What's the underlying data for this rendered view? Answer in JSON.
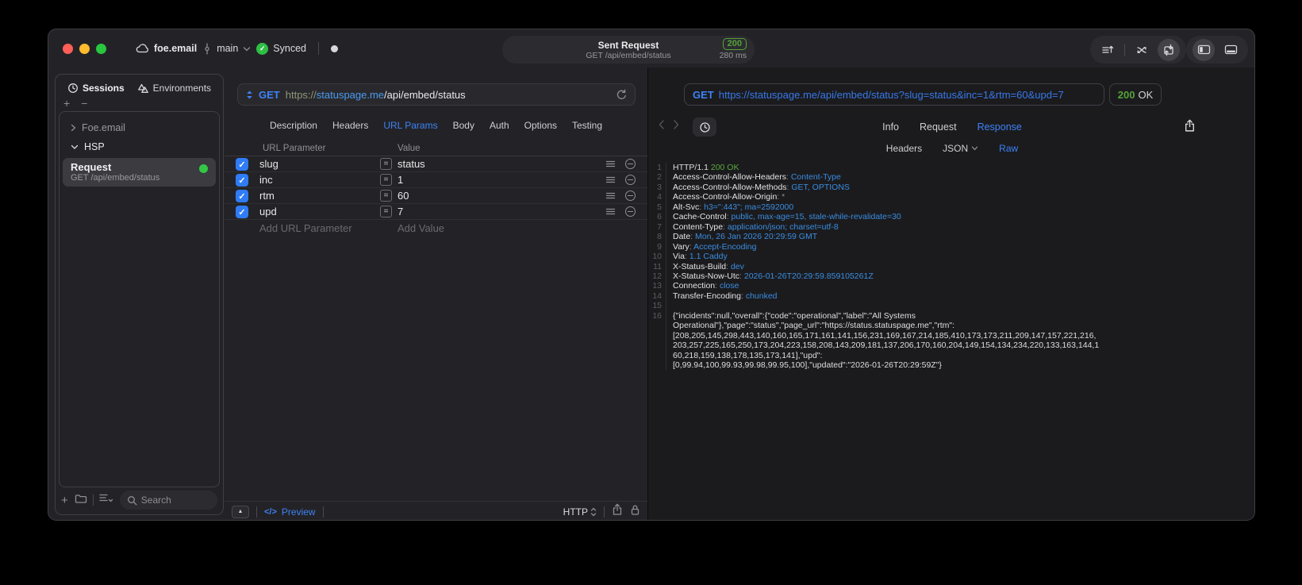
{
  "titlebar": {
    "project": "foe.email",
    "branch": "main",
    "sync_status": "Synced",
    "request_pill": {
      "title": "Sent Request",
      "subtitle": "GET /api/embed/status",
      "status": "200",
      "time": "280 ms"
    }
  },
  "sidebar": {
    "tabs": [
      {
        "label": "Sessions"
      },
      {
        "label": "Environments"
      }
    ],
    "tree": [
      {
        "label": "Foe.email"
      },
      {
        "label": "HSP"
      }
    ],
    "request_item": {
      "title": "Request",
      "subtitle": "GET /api/embed/status"
    },
    "search_placeholder": "Search"
  },
  "request_panel": {
    "method": "GET",
    "url": {
      "scheme": "https://",
      "host": "statuspage.me",
      "path": "/api/embed/status"
    },
    "tabs": [
      "Description",
      "Headers",
      "URL Params",
      "Body",
      "Auth",
      "Options",
      "Testing"
    ],
    "active_tab": "URL Params",
    "table": {
      "columns": [
        "URL Parameter",
        "Value"
      ],
      "rows": [
        {
          "name": "slug",
          "value": "status",
          "checked": true
        },
        {
          "name": "inc",
          "value": "1",
          "checked": true
        },
        {
          "name": "rtm",
          "value": "60",
          "checked": true
        },
        {
          "name": "upd",
          "value": "7",
          "checked": true
        }
      ],
      "add_row": {
        "name_placeholder": "Add URL Parameter",
        "value_placeholder": "Add Value"
      }
    },
    "footer": {
      "code_glyph": "</>",
      "preview": "Preview",
      "format": "HTTP"
    }
  },
  "response_panel": {
    "request_line": {
      "method": "GET",
      "url": "https://statuspage.me/api/embed/status?slug=status&inc=1&rtm=60&upd=7"
    },
    "status": {
      "code": "200",
      "text": "OK"
    },
    "tabs": [
      "Info",
      "Request",
      "Response"
    ],
    "active_tab": "Response",
    "subtabs": [
      "Headers",
      "JSON",
      "Raw"
    ],
    "active_subtab": "Raw",
    "body_lines": [
      {
        "n": "1",
        "parts": [
          [
            "plain",
            "HTTP/1.1 "
          ],
          [
            "green",
            "200 OK"
          ]
        ]
      },
      {
        "n": "2",
        "parts": [
          [
            "name",
            "Access-Control-Allow-Headers"
          ],
          [
            "punct",
            ": "
          ],
          [
            "blue",
            "Content-Type"
          ]
        ]
      },
      {
        "n": "3",
        "parts": [
          [
            "name",
            "Access-Control-Allow-Methods"
          ],
          [
            "punct",
            ": "
          ],
          [
            "blue",
            "GET, OPTIONS"
          ]
        ]
      },
      {
        "n": "4",
        "parts": [
          [
            "name",
            "Access-Control-Allow-Origin"
          ],
          [
            "punct",
            ": "
          ],
          [
            "punct",
            "*"
          ]
        ]
      },
      {
        "n": "5",
        "parts": [
          [
            "name",
            "Alt-Svc"
          ],
          [
            "punct",
            ": "
          ],
          [
            "blue",
            "h3=\":443\"; ma=2592000"
          ]
        ]
      },
      {
        "n": "6",
        "parts": [
          [
            "name",
            "Cache-Control"
          ],
          [
            "punct",
            ": "
          ],
          [
            "blue",
            "public, max-age=15, stale-while-revalidate=30"
          ]
        ]
      },
      {
        "n": "7",
        "parts": [
          [
            "name",
            "Content-Type"
          ],
          [
            "punct",
            ": "
          ],
          [
            "blue",
            "application/json; charset=utf-8"
          ]
        ]
      },
      {
        "n": "8",
        "parts": [
          [
            "name",
            "Date"
          ],
          [
            "punct",
            ": "
          ],
          [
            "blue",
            "Mon, 26 Jan 2026 20:29:59 GMT"
          ]
        ]
      },
      {
        "n": "9",
        "parts": [
          [
            "name",
            "Vary"
          ],
          [
            "punct",
            ": "
          ],
          [
            "blue",
            "Accept-Encoding"
          ]
        ]
      },
      {
        "n": "10",
        "parts": [
          [
            "name",
            "Via"
          ],
          [
            "punct",
            ": "
          ],
          [
            "blue",
            "1.1 Caddy"
          ]
        ]
      },
      {
        "n": "11",
        "parts": [
          [
            "name",
            "X-Status-Build"
          ],
          [
            "punct",
            ": "
          ],
          [
            "blue",
            "dev"
          ]
        ]
      },
      {
        "n": "12",
        "parts": [
          [
            "name",
            "X-Status-Now-Utc"
          ],
          [
            "punct",
            ": "
          ],
          [
            "blue",
            "2026-01-26T20:29:59.859105261Z"
          ]
        ]
      },
      {
        "n": "13",
        "parts": [
          [
            "name",
            "Connection"
          ],
          [
            "punct",
            ": "
          ],
          [
            "blue",
            "close"
          ]
        ]
      },
      {
        "n": "14",
        "parts": [
          [
            "name",
            "Transfer-Encoding"
          ],
          [
            "punct",
            ": "
          ],
          [
            "blue",
            "chunked"
          ]
        ]
      },
      {
        "n": "15",
        "parts": []
      },
      {
        "n": "16",
        "parts": [
          [
            "plain",
            "{\"incidents\":null,\"overall\":{\"code\":\"operational\",\"label\":\"All Systems"
          ]
        ]
      },
      {
        "n": "",
        "parts": [
          [
            "plain",
            "Operational\"},\"page\":\"status\",\"page_url\":\"https://status.statuspage.me\",\"rtm\":"
          ]
        ]
      },
      {
        "n": "",
        "parts": [
          [
            "plain",
            "[208,205,145,298,443,140,160,165,171,161,141,156,231,169,167,214,185,410,173,173,211,209,147,157,221,216,"
          ]
        ]
      },
      {
        "n": "",
        "parts": [
          [
            "plain",
            "203,257,225,165,250,173,204,223,158,208,143,209,181,137,206,170,160,204,149,154,134,234,220,133,163,144,1"
          ]
        ]
      },
      {
        "n": "",
        "parts": [
          [
            "plain",
            "60,218,159,138,178,135,173,141],\"upd\":"
          ]
        ]
      },
      {
        "n": "",
        "parts": [
          [
            "plain",
            "[0,99.94,100,99.93,99.98,99.95,100],\"updated\":\"2026-01-26T20:29:59Z\"}"
          ]
        ]
      }
    ]
  },
  "colors": {
    "accent_blue": "#3e82f6",
    "url_blue": "#3878e8",
    "green": "#32c846",
    "status_green": "#55a339",
    "code_blue": "#3a8de0"
  }
}
